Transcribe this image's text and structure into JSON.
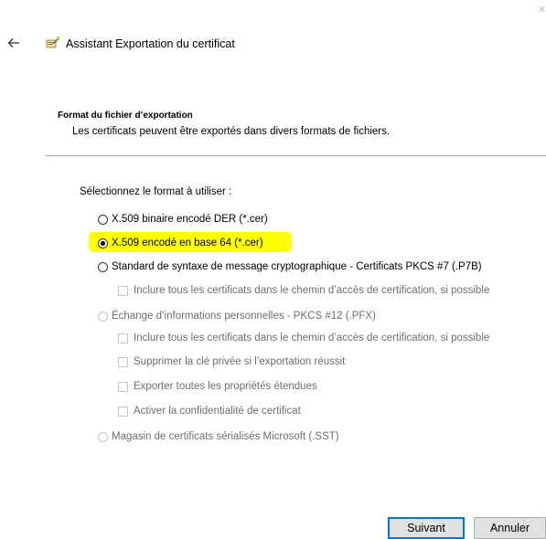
{
  "window": {
    "title": "Assistant Exportation du certificat"
  },
  "section": {
    "title": "Format du fichier d’exportation",
    "description": "Les certificats peuvent être exportés dans divers formats de fichiers."
  },
  "prompt": "Sélectionnez le format à utiliser :",
  "options": {
    "der": {
      "label": "X.509 binaire encodé DER (*.cer)",
      "selected": false,
      "enabled": true
    },
    "base64": {
      "label": "X.509 encodé en base 64 (*.cer)",
      "selected": true,
      "enabled": true
    },
    "pkcs7": {
      "label": "Standard de syntaxe de message cryptographique - Certificats PKCS #7 (.P7B)",
      "selected": false,
      "enabled": true
    },
    "pkcs7_include_all": {
      "label": "Inclure tous les certificats dans le chemin d’accès de certification, si possible",
      "checked": false,
      "enabled": false
    },
    "pfx": {
      "label": "Échange d’informations personnelles - PKCS #12 (.PFX)",
      "selected": false,
      "enabled": false
    },
    "pfx_include_all": {
      "label": "Inclure tous les certificats dans le chemin d’accès de certification, si possible",
      "checked": false,
      "enabled": false
    },
    "pfx_delete_key": {
      "label": "Supprimer la clé privée si l’exportation réussit",
      "checked": false,
      "enabled": false
    },
    "pfx_export_ext": {
      "label": "Exporter toutes les propriétés étendues",
      "checked": false,
      "enabled": false
    },
    "pfx_privacy": {
      "label": "Activer la confidentialité de certificat",
      "checked": false,
      "enabled": false
    },
    "sst": {
      "label": "Magasin de certificats sérialisés Microsoft (.SST)",
      "selected": false,
      "enabled": false
    }
  },
  "buttons": {
    "next": "Suivant",
    "cancel": "Annuler"
  },
  "icons": {
    "close": "close-icon",
    "back": "back-arrow-icon",
    "wizard": "certificate-wizard-icon"
  },
  "colors": {
    "highlight": "#ffff00",
    "primary_button_border": "#0078d7"
  }
}
